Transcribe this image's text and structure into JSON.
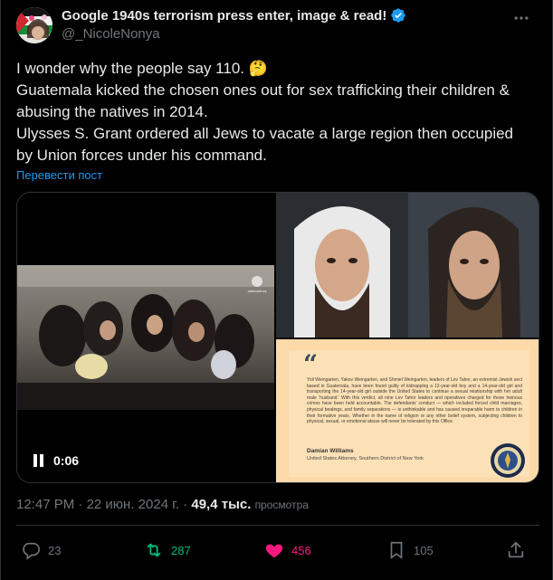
{
  "author": {
    "display_name": "Google 1940s terrorism press enter, image & read!",
    "handle": "@_NicoleNonya"
  },
  "tweet": {
    "lines": [
      "I wonder why the people say 110. 🤔",
      "Guatemala kicked the chosen ones out for sex trafficking their children &",
      "abusing the natives in 2014.",
      "Ulysses S. Grant ordered all Jews to vacate a large region then occupied",
      "by Union forces under his command."
    ],
    "translate_label": "Перевести пост"
  },
  "media": {
    "video_time": "0:06",
    "video_watermark": "ostorozh.us",
    "quote": {
      "mark": "“",
      "body": "Yoil Weingarten, Yakov Weingarten, and Shmiel Weingarten, leaders of Lev Tahor, an extremist Jewish sect based in Guatemala, have been found guilty of kidnapping a 12-year-old boy and a 14-year-old girl and transporting the 14-year-old girl outside the United States to continue a sexual relationship with her adult male ‘husband.’ With this verdict, all nine Lev Tahor leaders and operatives charged for these heinous crimes have been held accountable. The defendants’ conduct — which included forced child marriages, physical beatings, and family separations — is unthinkable and has caused irreparable harm to children in their formative years. Whether in the name of religion or any other belief system, subjecting children to physical, sexual, or emotional abuse will never be tolerated by this Office.",
      "author": "Damian Williams",
      "role": "United States Attorney, Southern District of New York"
    }
  },
  "meta": {
    "time": "12:47 PM",
    "separator": " · ",
    "date": "22 июн. 2024 г.",
    "views_count": "49,4 тыс.",
    "views_label": "просмотра"
  },
  "actions": {
    "replies": "23",
    "reposts": "287",
    "likes": "456",
    "bookmarks": "105"
  },
  "colors": {
    "background": "#000000",
    "text": "#e7e9ea",
    "muted": "#71767b",
    "link": "#1d9bf0",
    "repost": "#00ba7c",
    "like": "#f91880"
  }
}
